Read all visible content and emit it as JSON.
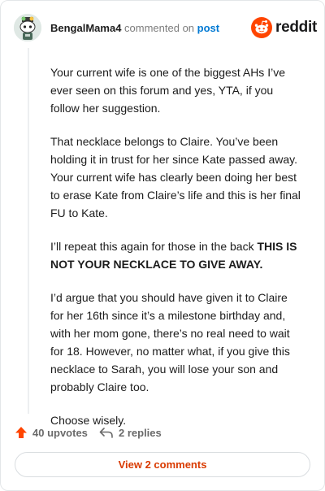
{
  "colors": {
    "upvote": "#ff4500",
    "link": "#0079d3",
    "view_comments": "#d93a00"
  },
  "header": {
    "username": "BengalMama4",
    "action": "commented on",
    "link": "post",
    "brand": "reddit",
    "avatar_icon": "snoo-avatar-icon",
    "brand_icon": "reddit-snoo-icon"
  },
  "comment": {
    "p1": "Your current wife is one of the biggest AHs I’ve ever seen on this forum and yes, YTA, if you follow her suggestion.",
    "p2": "That necklace belongs to Claire. You’ve been holding it in trust for her since Kate passed away. Your current wife has clearly been doing her best to erase Kate from Claire’s life and this is her final FU to Kate.",
    "p3_lead": "I’ll repeat this again for those in the back",
    "p3_bold": "THIS IS NOT YOUR NECKLACE TO GIVE AWAY.",
    "p4": "I’d argue that you should have given it to Claire for her 16th since it’s a milestone birthday and, with her mom gone, there’s no real need to wait for 18. However, no matter what, if you give this necklace to Sarah, you will lose your son and probably Claire too.",
    "p5": "Choose wisely."
  },
  "footer": {
    "upvotes": "40 upvotes",
    "replies": "2 replies",
    "upvote_icon": "upvote-arrow-icon",
    "reply_icon": "reply-arrow-icon"
  },
  "view_button": "View 2 comments"
}
